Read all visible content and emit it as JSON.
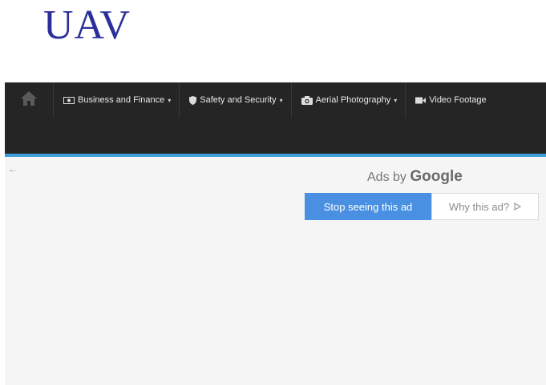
{
  "site": {
    "logo": "UAV"
  },
  "nav": {
    "home_icon": "home-icon",
    "items": [
      {
        "label": "Business and Finance",
        "icon": "money-icon"
      },
      {
        "label": "Safety and Security",
        "icon": "shield-icon"
      },
      {
        "label": "Aerial Photography",
        "icon": "camera-icon"
      },
      {
        "label": "Video Footage",
        "icon": "video-camera-icon"
      }
    ]
  },
  "ad": {
    "back_icon": "arrow-left-icon",
    "ads_by": "Ads by",
    "brand": "Google",
    "stop_button": "Stop seeing this ad",
    "why_button": "Why this ad?",
    "why_icon": "adchoices-icon"
  },
  "colors": {
    "logo": "#2b2f9a",
    "nav_bg": "#252525",
    "nav_accent": "#3d9fd9",
    "stop_button_bg": "#4a90e2"
  }
}
